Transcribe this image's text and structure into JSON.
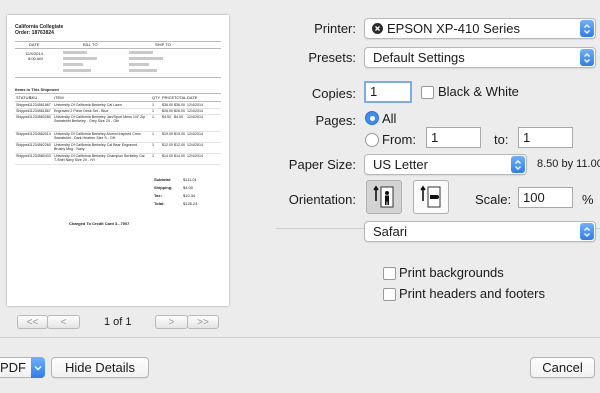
{
  "preview": {
    "company": "California Collegiate",
    "order": "Order: 18763824",
    "col_date": "DATE",
    "col_bill": "BILL TO",
    "col_ship": "SHIP TO",
    "date1": "12/4/2014",
    "date2": "8:00 AM",
    "items_heading": "Items in This Shipment",
    "headers": [
      "STATUS",
      "SKU",
      "ITEM",
      "QTY",
      "PRICE",
      "TOTAL",
      "DATE"
    ],
    "rows": [
      [
        "Shipped",
        "11234561867",
        "University Of California Berkeley Cal Lawn",
        "1",
        "$36.00",
        "$36.00",
        "12/4/2014"
      ],
      [
        "Shipped",
        "11234561867",
        "Engraved 2 Piece Desk Set - Blue",
        "1",
        "$26.00",
        "$26.00",
        "12/4/2014"
      ],
      [
        "Shipped",
        "11234560280",
        "University Of California Berkeley Jan/Sport Mens 1/4\" Zip Sweatshirt Berkeley - Grey Size 2X - Oth",
        "1",
        "$4.00",
        "$4.00",
        "12/4/2014"
      ],
      [
        "Shipped",
        "11234562014",
        "University Of California Berkeley Alumni Inspired Crew Sweatshirt - Dark Heather Size S - OH",
        "1",
        "$19.00",
        "$19.00",
        "12/4/2014"
      ],
      [
        "Shipped",
        "11234562260",
        "University Of California Berkeley Cal Bear Engraved Brushy Mug - Navy",
        "1",
        "$12.00",
        "$12.00",
        "12/4/2014"
      ],
      [
        "Shipped",
        "11234560433",
        "University Of California Berkeley Champion Berkeley Cal T-Shirt Navy Size 2X - NY",
        "1",
        "$14.00",
        "$14.00",
        "12/4/2014"
      ]
    ],
    "totals": [
      {
        "label": "Subtotal:",
        "value": "$111.01"
      },
      {
        "label": "Shipping:",
        "value": "$4.00"
      },
      {
        "label": "Tax:",
        "value": "$10.34"
      },
      {
        "label": "Total:",
        "value": "$126.24"
      }
    ],
    "charged": "Charged To Credit Card 3...7007"
  },
  "pager": {
    "first": "<<",
    "prev": "<",
    "next": ">",
    "last": ">>",
    "label": "1 of 1"
  },
  "printer": {
    "label": "Printer:",
    "value": "EPSON XP-410 Series"
  },
  "presets": {
    "label": "Presets:",
    "value": "Default Settings"
  },
  "copies": {
    "label": "Copies:",
    "value": "1",
    "bw_label": "Black & White"
  },
  "pages": {
    "label": "Pages:",
    "all_label": "All",
    "from_label": "From:",
    "from_value": "1",
    "to_label": "to:",
    "to_value": "1"
  },
  "paper_size": {
    "label": "Paper Size:",
    "value": "US Letter",
    "dims": "8.50 by 11.00"
  },
  "orientation": {
    "label": "Orientation:"
  },
  "scale": {
    "label": "Scale:",
    "value": "100",
    "unit": "%"
  },
  "app_section": {
    "value": "Safari"
  },
  "options": {
    "backgrounds": "Print backgrounds",
    "headers_footers": "Print headers and footers"
  },
  "bottom": {
    "pdf": "PDF",
    "hide_details": "Hide Details",
    "cancel": "Cancel"
  },
  "accent": "#3c8cf2"
}
